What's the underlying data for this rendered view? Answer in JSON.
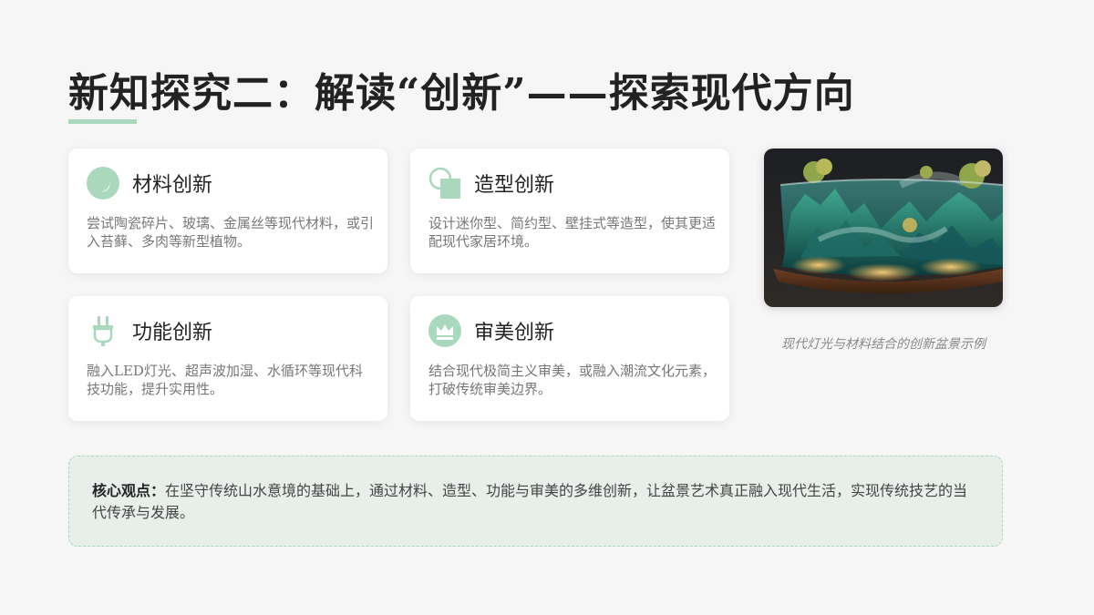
{
  "slide": {
    "title": "新知探究二：解读“创新”——探索现代方向",
    "accent_color": "#a9d8bd"
  },
  "cards": [
    {
      "title": "材料创新",
      "icon": "moon-circle-icon",
      "desc": "尝试陶瓷碎片、玻璃、金属丝等现代材料，或引入苔藓、多肉等新型植物。"
    },
    {
      "title": "造型创新",
      "icon": "shapes-icon",
      "desc": "设计迷你型、简约型、壁挂式等造型，使其更适配现代家居环境。"
    },
    {
      "title": "功能创新",
      "icon": "plug-icon",
      "desc": "融入LED灯光、超声波加湿、水循环等现代科技功能，提升实用性。"
    },
    {
      "title": "审美创新",
      "icon": "crown-icon",
      "desc": "结合现代极简主义审美，或融入潮流文化元素，打破传统审美边界。"
    }
  ],
  "figure": {
    "caption": "现代灯光与材料结合的创新盆景示例"
  },
  "core": {
    "label": "核心观点：",
    "text": "在坚守传统山水意境的基础上，通过材料、造型、功能与审美的多维创新，让盆景艺术真正融入现代生活，实现传统技艺的当代传承与发展。"
  }
}
